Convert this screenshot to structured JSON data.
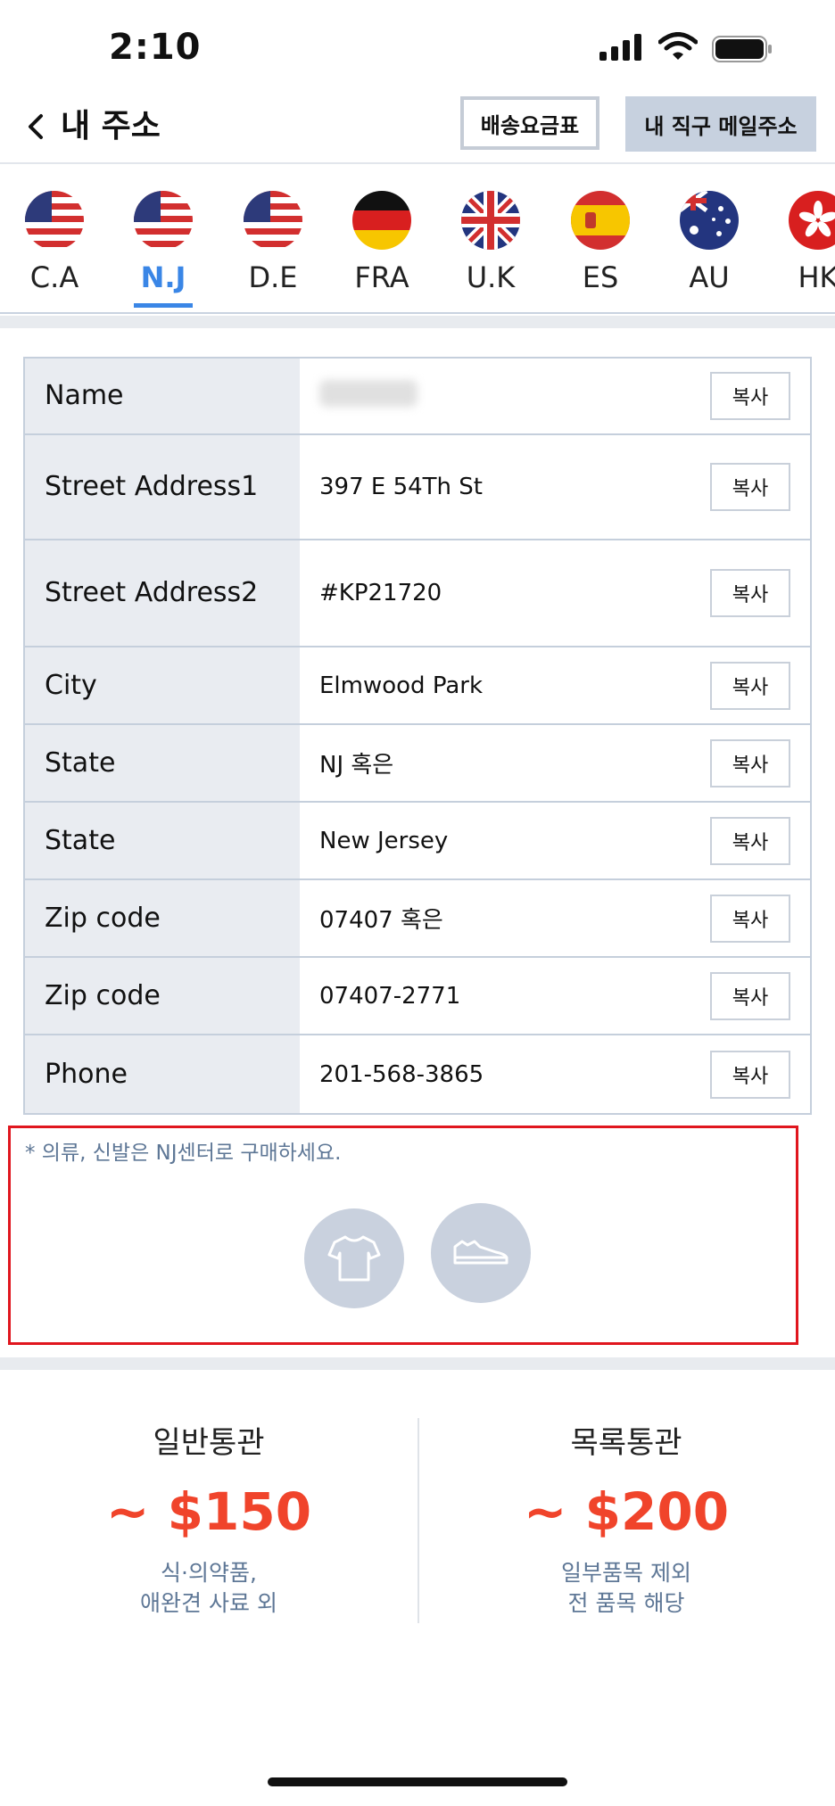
{
  "status_bar": {
    "time": "2:10"
  },
  "header": {
    "title": "내 주소",
    "rate_button": "배송요금표",
    "mail_button": "내 직구 메일주소"
  },
  "tabs": [
    {
      "label": "C.A",
      "flag": "us-flag-icon",
      "active": false
    },
    {
      "label": "N.J",
      "flag": "us-flag-icon",
      "active": true
    },
    {
      "label": "D.E",
      "flag": "us-flag-icon",
      "active": false
    },
    {
      "label": "FRA",
      "flag": "germany-flag-icon",
      "active": false
    },
    {
      "label": "U.K",
      "flag": "uk-flag-icon",
      "active": false
    },
    {
      "label": "ES",
      "flag": "spain-flag-icon",
      "active": false
    },
    {
      "label": "AU",
      "flag": "australia-flag-icon",
      "active": false
    },
    {
      "label": "HK",
      "flag": "hongkong-flag-icon",
      "active": false
    }
  ],
  "address": {
    "copy_label": "복사",
    "rows": [
      {
        "key": "Name",
        "value": ""
      },
      {
        "key": "Street Address1",
        "value": "397 E 54Th St"
      },
      {
        "key": "Street Address2",
        "value": "#KP21720"
      },
      {
        "key": "City",
        "value": "Elmwood Park"
      },
      {
        "key": "State",
        "value": "NJ 혹은"
      },
      {
        "key": "State",
        "value": "New Jersey"
      },
      {
        "key": "Zip code",
        "value": "07407 혹은"
      },
      {
        "key": "Zip code",
        "value": "07407-2771"
      },
      {
        "key": "Phone",
        "value": "201-568-3865"
      }
    ]
  },
  "notice": {
    "text": "* 의류, 신발은 NJ센터로 구매하세요.",
    "icons": [
      "tshirt-icon",
      "sneaker-icon"
    ]
  },
  "customs": {
    "general": {
      "title": "일반통관",
      "price": "~ $150",
      "desc_line1": "식·의약품,",
      "desc_line2": "애완견 사료 외"
    },
    "list": {
      "title": "목록통관",
      "price": "~ $200",
      "desc_line1": "일부품목 제외",
      "desc_line2": "전 품목 해당"
    }
  },
  "colors": {
    "accent": "#3a86e6",
    "price": "#f0442b",
    "notice_border": "#e0161e"
  }
}
